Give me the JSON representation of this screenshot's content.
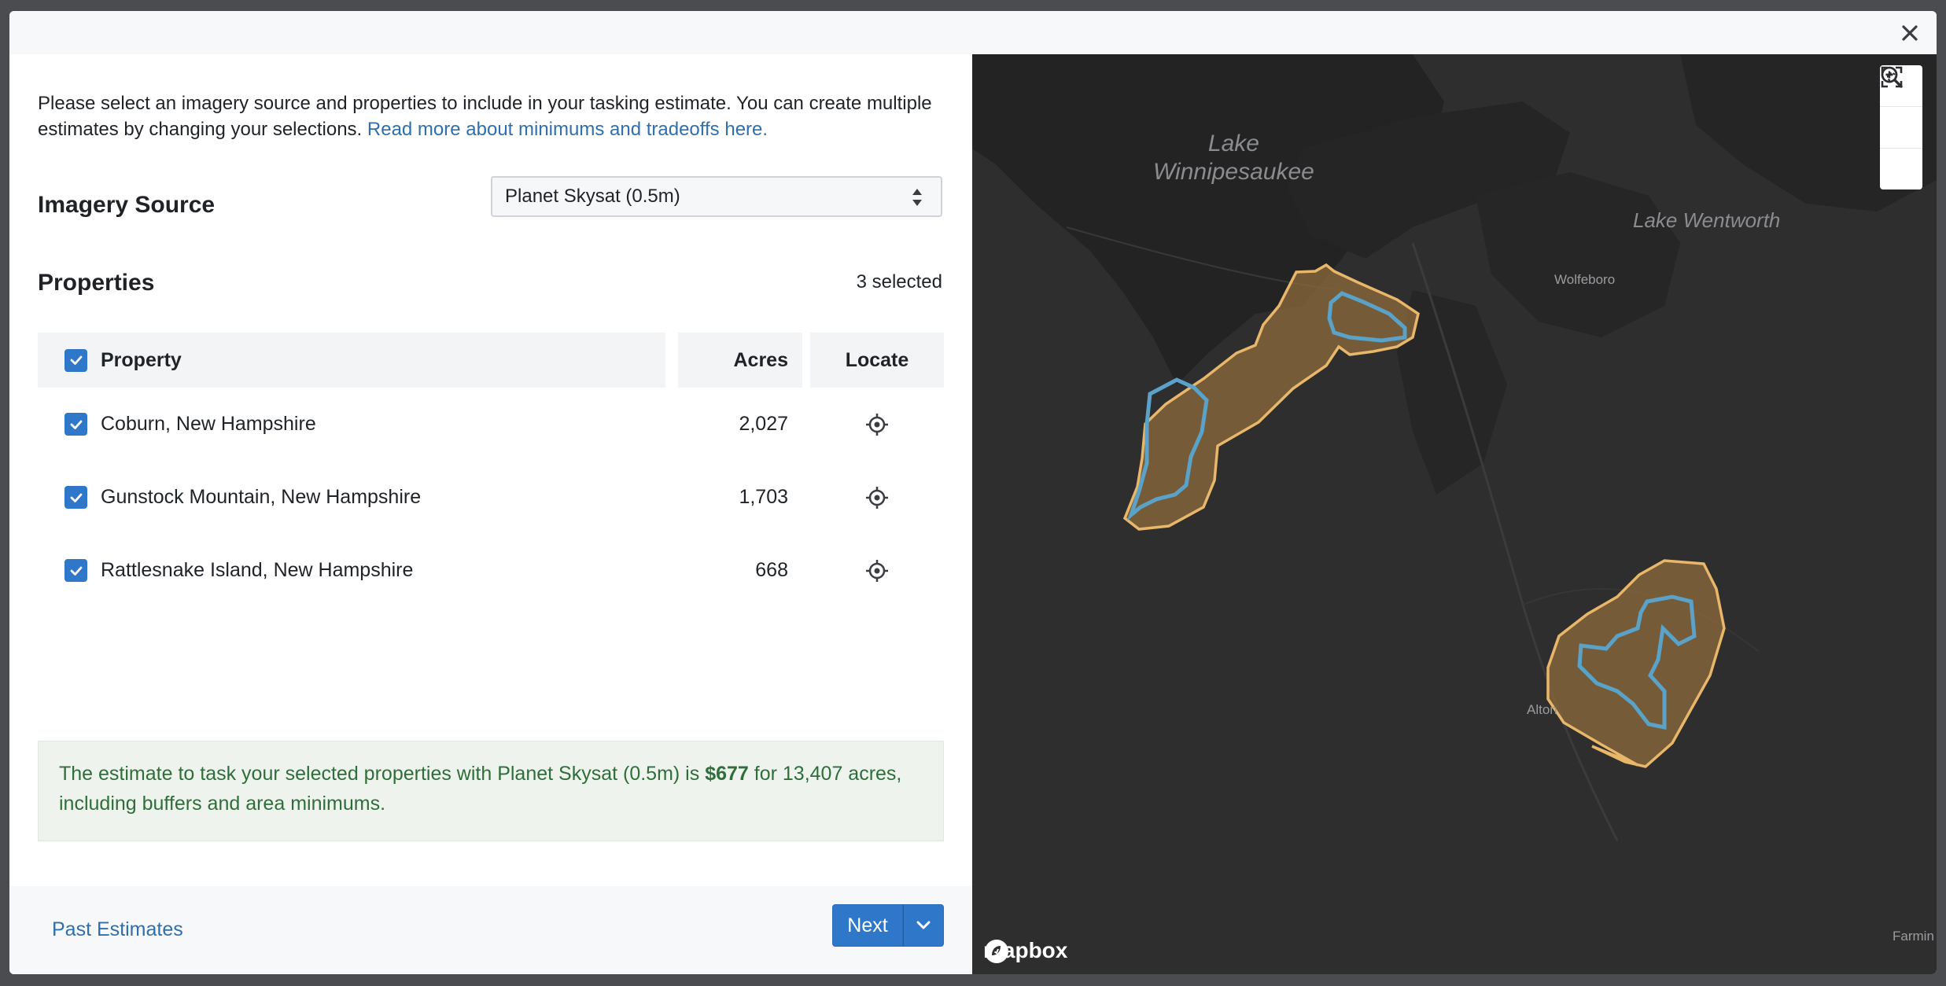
{
  "intro": {
    "text": "Please select an imagery source and properties to include in your tasking estimate. You can create multiple estimates by changing your selections.",
    "link": "Read more about minimums and tradeoffs here."
  },
  "imagery": {
    "label": "Imagery Source",
    "selected": "Planet Skysat (0.5m)"
  },
  "properties": {
    "label": "Properties",
    "count": "3 selected",
    "columns": {
      "property": "Property",
      "acres": "Acres",
      "locate": "Locate"
    },
    "rows": [
      {
        "name": "Coburn, New Hampshire",
        "acres": "2,027"
      },
      {
        "name": "Gunstock Mountain, New Hampshire",
        "acres": "1,703"
      },
      {
        "name": "Rattlesnake Island, New Hampshire",
        "acres": "668"
      }
    ]
  },
  "estimate": {
    "prefix": "The estimate to task your selected properties with Planet Skysat (0.5m) is",
    "price": "$677",
    "suffix": "for 13,407 acres, including buffers and area minimums."
  },
  "footer": {
    "past": "Past Estimates",
    "next": "Next"
  },
  "map": {
    "labels": {
      "lake1_line1": "Lake",
      "lake1_line2": "Winnipesaukee",
      "lake2": "Lake Wentworth"
    },
    "towns": {
      "wolfeboro": "Wolfeboro",
      "alton": "Alton",
      "farmington": "Farmin"
    },
    "brand": "mapbox"
  },
  "colors": {
    "accent": "#2f78c9",
    "link": "#2f6fae",
    "estimate_text": "#2f6e3a",
    "buffer": "#e8b76a",
    "parcel": "#5aa2c8"
  },
  "icons": {
    "close": "close-icon",
    "locate": "crosshair-icon",
    "zoom_in": "zoom-in-icon",
    "zoom_out": "zoom-out-icon",
    "fit": "fit-bounds-icon"
  }
}
